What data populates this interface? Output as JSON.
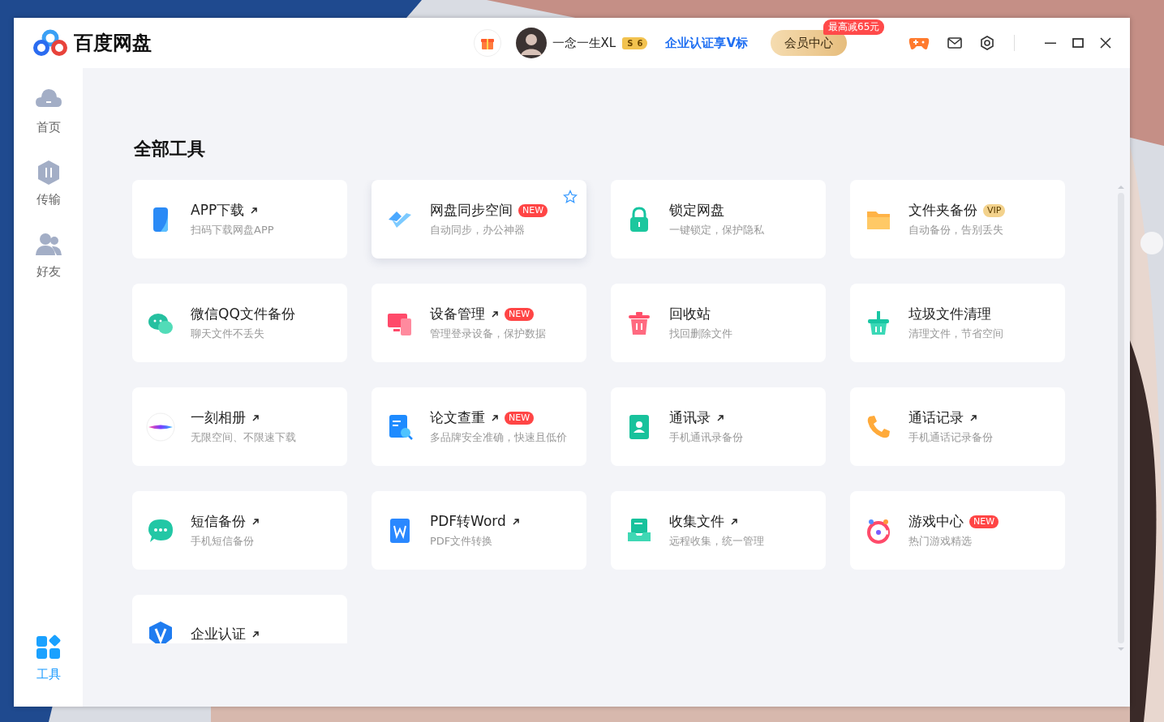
{
  "app": {
    "name": "百度网盘"
  },
  "header": {
    "username": "一念一生XL",
    "level": {
      "letter": "S",
      "number": "6"
    },
    "enterprise_link": "企业认证享V标",
    "member_button": "会员中心",
    "member_badge": "最高减65元"
  },
  "sidebar": {
    "items": [
      {
        "label": "首页",
        "selected": false
      },
      {
        "label": "传输",
        "selected": false
      },
      {
        "label": "好友",
        "selected": false
      },
      {
        "label": "工具",
        "selected": true
      }
    ]
  },
  "page_title": "全部工具",
  "tools": [
    {
      "title": "APP下载",
      "subtitle": "扫码下载网盘APP",
      "external": true,
      "hovered": false
    },
    {
      "title": "网盘同步空间",
      "subtitle": "自动同步，办公神器",
      "external": false,
      "badge": {
        "text": "NEW",
        "kind": "new"
      },
      "hovered": true
    },
    {
      "title": "锁定网盘",
      "subtitle": "一键锁定，保护隐私",
      "external": false,
      "hovered": false
    },
    {
      "title": "文件夹备份",
      "subtitle": "自动备份，告别丢失",
      "external": false,
      "badge": {
        "text": "VIP",
        "kind": "vip"
      },
      "hovered": false
    },
    {
      "title": "微信QQ文件备份",
      "subtitle": "聊天文件不丢失",
      "external": false,
      "hovered": false
    },
    {
      "title": "设备管理",
      "subtitle": "管理登录设备，保护数据",
      "external": true,
      "badge": {
        "text": "NEW",
        "kind": "new"
      },
      "hovered": false
    },
    {
      "title": "回收站",
      "subtitle": "找回删除文件",
      "external": false,
      "hovered": false
    },
    {
      "title": "垃圾文件清理",
      "subtitle": "清理文件，节省空间",
      "external": false,
      "hovered": false
    },
    {
      "title": "一刻相册",
      "subtitle": "无限空间、不限速下载",
      "external": true,
      "hovered": false
    },
    {
      "title": "论文查重",
      "subtitle": "多品牌安全准确，快速且低价",
      "external": true,
      "badge": {
        "text": "NEW",
        "kind": "new"
      },
      "hovered": false
    },
    {
      "title": "通讯录",
      "subtitle": "手机通讯录备份",
      "external": true,
      "hovered": false
    },
    {
      "title": "通话记录",
      "subtitle": "手机通话记录备份",
      "external": true,
      "hovered": false
    },
    {
      "title": "短信备份",
      "subtitle": "手机短信备份",
      "external": true,
      "hovered": false
    },
    {
      "title": "PDF转Word",
      "subtitle": "PDF文件转换",
      "external": true,
      "hovered": false
    },
    {
      "title": "收集文件",
      "subtitle": "远程收集，统一管理",
      "external": true,
      "hovered": false
    },
    {
      "title": "游戏中心",
      "subtitle": "热门游戏精选",
      "external": false,
      "badge": {
        "text": "NEW",
        "kind": "new"
      },
      "hovered": false
    },
    {
      "title": "企业认证",
      "external": true,
      "hovered": false
    }
  ]
}
